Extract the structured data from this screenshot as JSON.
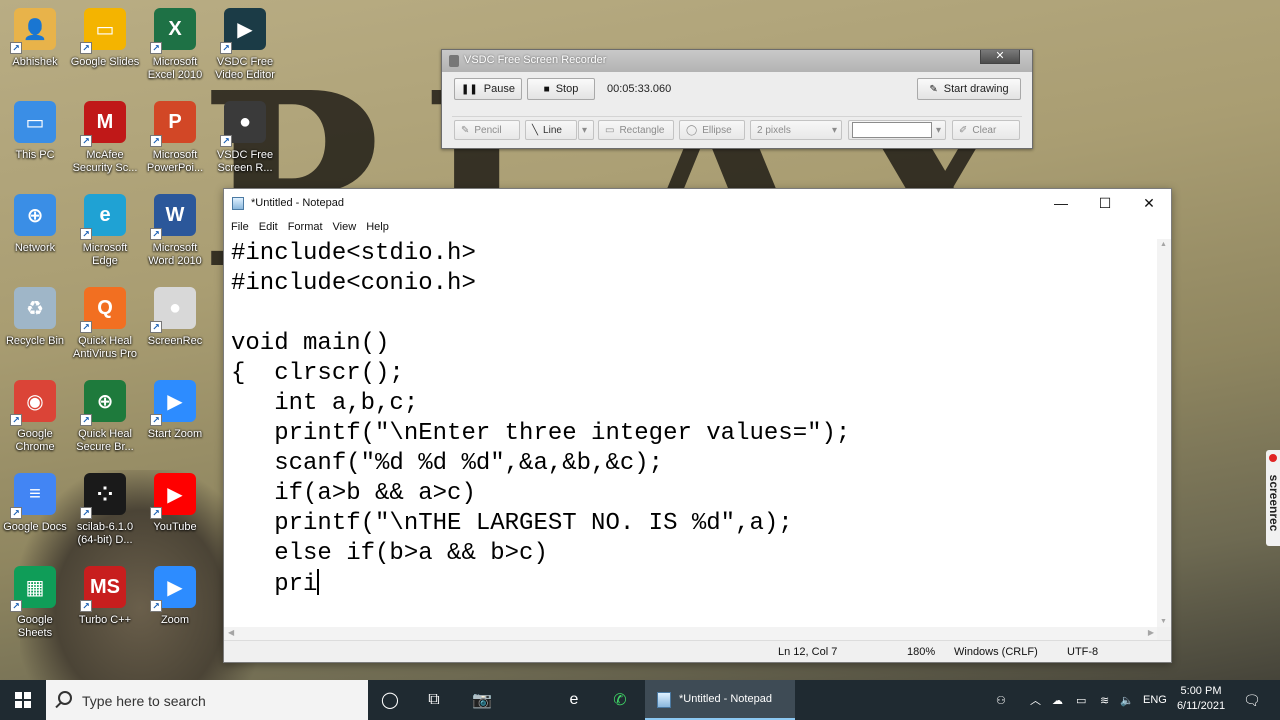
{
  "desktop": {
    "icons": [
      {
        "label": "Abhishek",
        "icon": "user-folder-icon",
        "color": "#e8b34a",
        "glyph": "👤"
      },
      {
        "label": "Google Slides",
        "icon": "google-slides-icon",
        "color": "#f4b400",
        "glyph": "▭"
      },
      {
        "label": "Microsoft\nExcel 2010",
        "icon": "excel-icon",
        "color": "#1e7145",
        "glyph": "X"
      },
      {
        "label": "VSDC Free\nVideo Editor",
        "icon": "vsdc-video-editor-icon",
        "color": "#1b3b46",
        "glyph": "▶"
      },
      {
        "label": "This PC",
        "icon": "this-pc-icon",
        "color": "#3a8ee6",
        "glyph": "▭"
      },
      {
        "label": "McAfee\nSecurity Sc...",
        "icon": "mcafee-icon",
        "color": "#c01818",
        "glyph": "M"
      },
      {
        "label": "Microsoft\nPowerPoi...",
        "icon": "powerpoint-icon",
        "color": "#d24726",
        "glyph": "P"
      },
      {
        "label": "VSDC Free\nScreen R...",
        "icon": "vsdc-screen-recorder-icon",
        "color": "#3a3a3a",
        "glyph": "●"
      },
      {
        "label": "Network",
        "icon": "network-icon",
        "color": "#3a8ee6",
        "glyph": "⊕"
      },
      {
        "label": "Microsoft\nEdge",
        "icon": "edge-icon",
        "color": "#1fa2d4",
        "glyph": "e"
      },
      {
        "label": "Microsoft\nWord 2010",
        "icon": "word-icon",
        "color": "#2b579a",
        "glyph": "W"
      },
      {
        "label": "Recycle Bin",
        "icon": "recycle-bin-icon",
        "color": "#9fb6c8",
        "glyph": "♻"
      },
      {
        "label": "Quick Heal\nAntiVirus Pro",
        "icon": "quick-heal-antivirus-icon",
        "color": "#f26f21",
        "glyph": "Q"
      },
      {
        "label": "ScreenRec",
        "icon": "screenrec-icon",
        "color": "#d8d8d8",
        "glyph": "●"
      },
      {
        "label": "Google\nChrome",
        "icon": "chrome-icon",
        "color": "#db4437",
        "glyph": "◉"
      },
      {
        "label": "Quick Heal\nSecure Br...",
        "icon": "quick-heal-browser-icon",
        "color": "#1e7a3c",
        "glyph": "⊕"
      },
      {
        "label": "Start Zoom",
        "icon": "zoom-start-icon",
        "color": "#2d8cff",
        "glyph": "▶"
      },
      {
        "label": "Google Docs",
        "icon": "google-docs-icon",
        "color": "#4285f4",
        "glyph": "≡"
      },
      {
        "label": "scilab-6.1.0\n(64-bit) D...",
        "icon": "scilab-icon",
        "color": "#1a1a1a",
        "glyph": "⁘"
      },
      {
        "label": "YouTube",
        "icon": "youtube-icon",
        "color": "#ff0000",
        "glyph": "▶"
      },
      {
        "label": "Google\nSheets",
        "icon": "google-sheets-icon",
        "color": "#0f9d58",
        "glyph": "▦"
      },
      {
        "label": "Turbo C++",
        "icon": "turbo-cpp-icon",
        "color": "#c81e1e",
        "glyph": "MS"
      },
      {
        "label": "Zoom",
        "icon": "zoom-icon",
        "color": "#2d8cff",
        "glyph": "▶"
      }
    ]
  },
  "wallpaper_text": "PLAY",
  "vsdc": {
    "title": "VSDC Free Screen Recorder",
    "close": "✕",
    "pause": "Pause",
    "stop": "Stop",
    "time": "00:05:33.060",
    "start_drawing": "Start drawing",
    "pencil": "Pencil",
    "line": "Line",
    "rectangle": "Rectangle",
    "ellipse": "Ellipse",
    "pixels": "2 pixels",
    "clear": "Clear"
  },
  "notepad": {
    "title": "*Untitled - Notepad",
    "menu": [
      "File",
      "Edit",
      "Format",
      "View",
      "Help"
    ],
    "lines": [
      "#include<stdio.h>",
      "#include<conio.h>",
      "",
      "void main()",
      "{  clrscr();",
      "   int a,b,c;",
      "   printf(\"\\nEnter three integer values=\");",
      "   scanf(\"%d %d %d\",&a,&b,&c);",
      "   if(a>b && a>c)",
      "   printf(\"\\nTHE LARGEST NO. IS %d\",a);",
      "   else if(b>a && b>c)",
      "   pri"
    ],
    "status": {
      "position": "Ln 12, Col 7",
      "zoom": "180%",
      "line_endings": "Windows (CRLF)",
      "encoding": "UTF-8"
    }
  },
  "screenrec_tab": "screenrec",
  "taskbar": {
    "search_placeholder": "Type here to search",
    "active_app": "*Untitled - Notepad",
    "language": "ENG",
    "time": "5:00 PM",
    "date": "6/11/2021"
  }
}
